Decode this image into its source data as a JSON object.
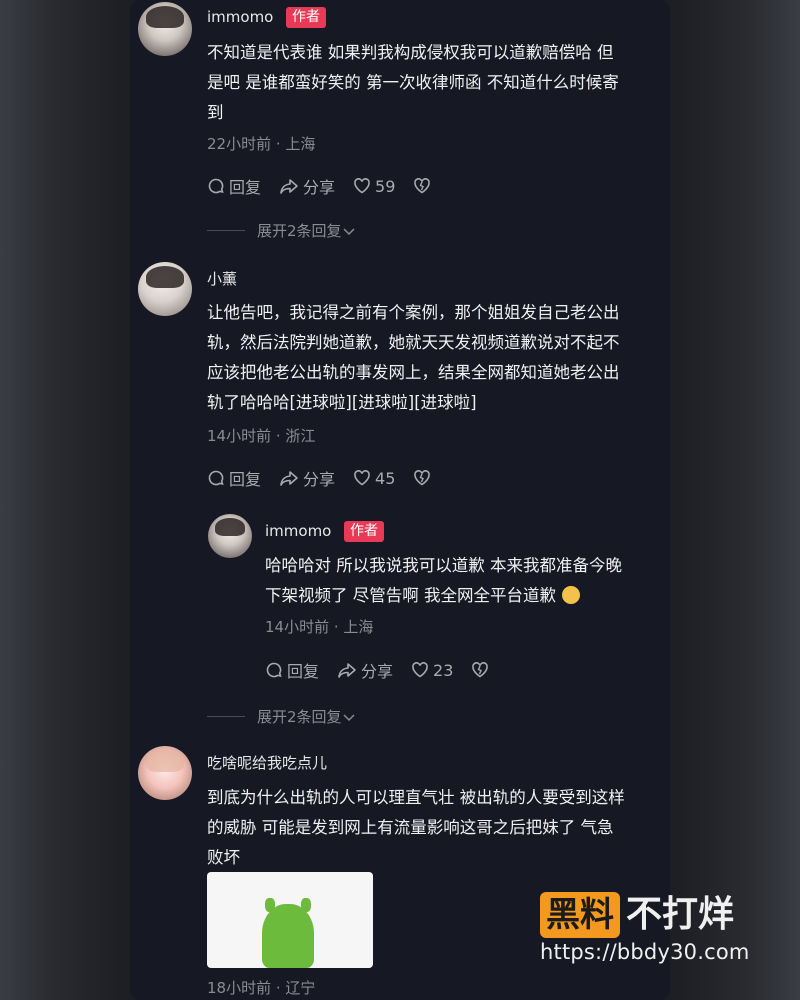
{
  "comments": [
    {
      "username": "immomo",
      "author_tag": "作者",
      "lines": [
        "不知道是代表谁 如果判我构成侵权我可以道歉赔偿哈 但",
        "是吧 是谁都蛮好笑的 第一次收律师函 不知道什么时候寄",
        "到"
      ],
      "meta": "22小时前 · 上海",
      "reply_label": "回复",
      "share_label": "分享",
      "likes": "59",
      "expand": "展开2条回复"
    },
    {
      "username": "小薰",
      "lines": [
        "让他告吧，我记得之前有个案例，那个姐姐发自己老公出",
        "轨，然后法院判她道歉，她就天天发视频道歉说对不起不",
        "应该把他老公出轨的事发网上，结果全网都知道她老公出",
        "轨了哈哈哈[进球啦][进球啦][进球啦]"
      ],
      "meta": "14小时前 · 浙江",
      "reply_label": "回复",
      "share_label": "分享",
      "likes": "45"
    },
    {
      "username": "immomo",
      "author_tag": "作者",
      "lines": [
        "哈哈哈对 所以我说我可以道歉 本来我都准备今晚",
        "下架视频了 尽管告啊 我全网全平台道歉"
      ],
      "meta": "14小时前 · 上海",
      "reply_label": "回复",
      "share_label": "分享",
      "likes": "23",
      "expand": "展开2条回复"
    },
    {
      "username": "吃啥呢给我吃点儿",
      "lines": [
        "到底为什么出轨的人可以理直气壮 被出轨的人要受到这样",
        "的威胁 可能是发到网上有流量影响这哥之后把妹了 气急",
        "败坏"
      ],
      "meta": "18小时前 · 辽宁"
    }
  ],
  "watermark": {
    "box": "黑料",
    "title": "不打烊",
    "url": "https://bbdy30.com"
  },
  "colors": {
    "author_tag": "#e83a57",
    "panel": "#161823",
    "watermark": "#f39a1e"
  }
}
